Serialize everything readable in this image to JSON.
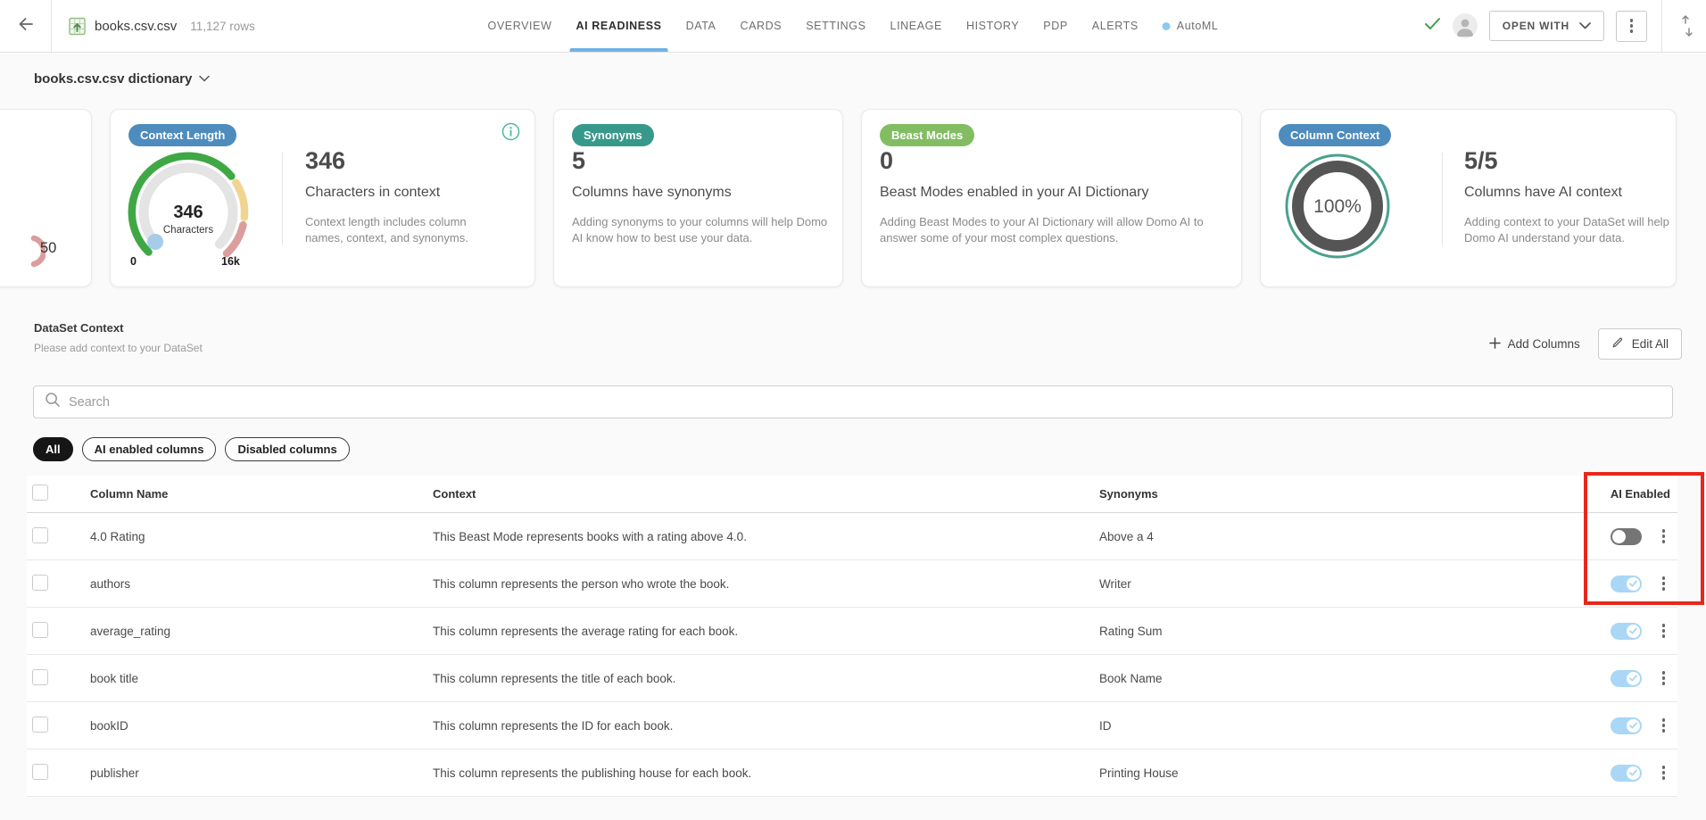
{
  "header": {
    "title": "books.csv.csv",
    "row_count": "11,127 rows",
    "tabs": [
      {
        "label": "OVERVIEW",
        "active": false
      },
      {
        "label": "AI READINESS",
        "active": true
      },
      {
        "label": "DATA",
        "active": false
      },
      {
        "label": "CARDS",
        "active": false
      },
      {
        "label": "SETTINGS",
        "active": false
      },
      {
        "label": "LINEAGE",
        "active": false
      },
      {
        "label": "HISTORY",
        "active": false
      },
      {
        "label": "PDP",
        "active": false
      },
      {
        "label": "ALERTS",
        "active": false
      },
      {
        "label": "AutoML",
        "active": false,
        "dot": true
      }
    ],
    "open_with": {
      "label": "OPEN WITH"
    }
  },
  "page": {
    "title": "books.csv.csv dictionary"
  },
  "summary_cards": {
    "partial": {
      "value": "50"
    },
    "context_length": {
      "badge": "Context Length",
      "center_value": "346",
      "center_label": "Characters",
      "axis_min": "0",
      "axis_max": "16k",
      "stat": "346",
      "stat_label": "Characters in context",
      "description": "Context length includes column names, context, and synonyms."
    },
    "synonyms": {
      "badge": "Synonyms",
      "stat": "5",
      "stat_label": "Columns have synonyms",
      "description": "Adding synonyms to your columns will help Domo AI know how to best use your data."
    },
    "beast_modes": {
      "badge": "Beast Modes",
      "stat": "0",
      "stat_label": "Beast Modes enabled in your AI Dictionary",
      "description": "Adding Beast Modes to your AI Dictionary will allow Domo AI to answer some of your most complex questions."
    },
    "column_context": {
      "badge": "Column Context",
      "donut_value": "100%",
      "stat": "5/5",
      "stat_label": "Columns have AI context",
      "description": "Adding context to your DataSet will help Domo AI understand your data."
    }
  },
  "dataset_context": {
    "title": "DataSet Context",
    "subtitle": "Please add context to your DataSet",
    "add_columns_label": "Add Columns",
    "edit_all_label": "Edit All"
  },
  "search": {
    "placeholder": "Search"
  },
  "filters": [
    {
      "label": "All",
      "active": true
    },
    {
      "label": "AI enabled columns",
      "active": false
    },
    {
      "label": "Disabled columns",
      "active": false
    }
  ],
  "table": {
    "columns": {
      "name": "Column Name",
      "context": "Context",
      "synonyms": "Synonyms",
      "ai_enabled": "AI Enabled"
    },
    "rows": [
      {
        "name": "4.0 Rating",
        "context": "This Beast Mode represents books with a rating above 4.0.",
        "synonyms": "Above a 4",
        "ai_enabled": false
      },
      {
        "name": "authors",
        "context": "This column represents the person who wrote the book.",
        "synonyms": "Writer",
        "ai_enabled": true
      },
      {
        "name": "average_rating",
        "context": "This column represents the average rating for each book.",
        "synonyms": "Rating Sum",
        "ai_enabled": true
      },
      {
        "name": "book title",
        "context": "This column represents the title of each book.",
        "synonyms": "Book Name",
        "ai_enabled": true
      },
      {
        "name": "bookID",
        "context": "This column represents the ID for each book.",
        "synonyms": "ID",
        "ai_enabled": true
      },
      {
        "name": "publisher",
        "context": "This column represents the publishing house for each book.",
        "synonyms": "Printing House",
        "ai_enabled": true
      }
    ]
  },
  "icons": {
    "back": "arrow-left",
    "file": "table-grid-arrow",
    "sync_status": "check",
    "avatar": "person",
    "open_with_chevron": "chevron-down",
    "more": "kebab-vertical",
    "sort": "arrows-up-down",
    "dictionary_chevron": "chevron-down",
    "info": "circle-i",
    "add": "plus",
    "edit": "pencil",
    "search": "magnifier",
    "automl_dot": "dot",
    "toggle_check": "check"
  },
  "colors": {
    "accent_blue": "#71b2e2",
    "badge_blue": "#4e8cbe",
    "badge_teal": "#37998a",
    "badge_green": "#82bd63",
    "gauge_green": "#3fa845",
    "gauge_yellow": "#f2d491",
    "gauge_red": "#dc9d9d",
    "gauge_marker_blue": "#a5cce9",
    "donut_ring_teal": "#4ba18c",
    "donut_ring_dark": "#555555",
    "toggle_on": "#a9d7f5",
    "toggle_off": "#757575",
    "annotation_red": "#e8271c",
    "automl_dot": "#8ecaf0",
    "check_green": "#43a047"
  }
}
